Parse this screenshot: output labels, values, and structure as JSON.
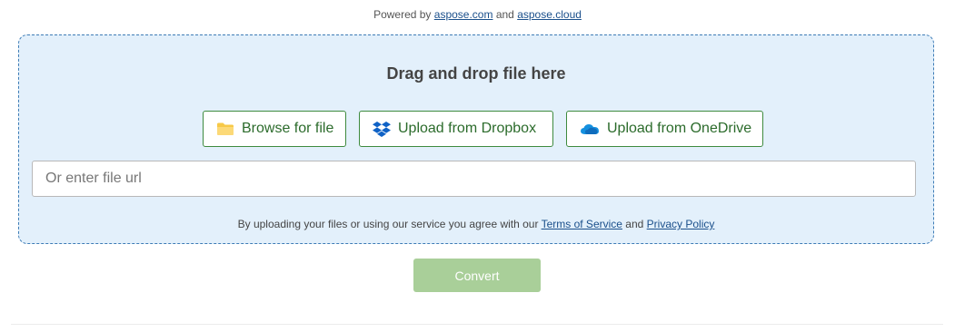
{
  "powered": {
    "prefix": "Powered by",
    "link1": "aspose.com",
    "middle": "and",
    "link2": "aspose.cloud"
  },
  "dropzone": {
    "title": "Drag and drop file here",
    "buttons": {
      "browse": {
        "label": "Browse for file",
        "icon": "folder-icon"
      },
      "dropbox": {
        "label": "Upload from Dropbox",
        "icon": "dropbox-icon"
      },
      "onedrive": {
        "label": "Upload from OneDrive",
        "icon": "onedrive-icon"
      }
    },
    "url_input": {
      "placeholder": "Or enter file url",
      "value": ""
    },
    "terms": {
      "prefix": "By uploading your files or using our service you agree with our",
      "tos_link": "Terms of Service",
      "middle": "and",
      "privacy_link": "Privacy Policy"
    }
  },
  "convert": {
    "label": "Convert",
    "disabled": true
  },
  "colors": {
    "dropzone_bg": "#e3f0fb",
    "dropzone_border": "#3e7cb6",
    "button_border": "#3e8a3e",
    "button_text": "#2b6b2b",
    "convert_disabled_bg": "#a9cf99",
    "link": "#1a4f8b"
  }
}
